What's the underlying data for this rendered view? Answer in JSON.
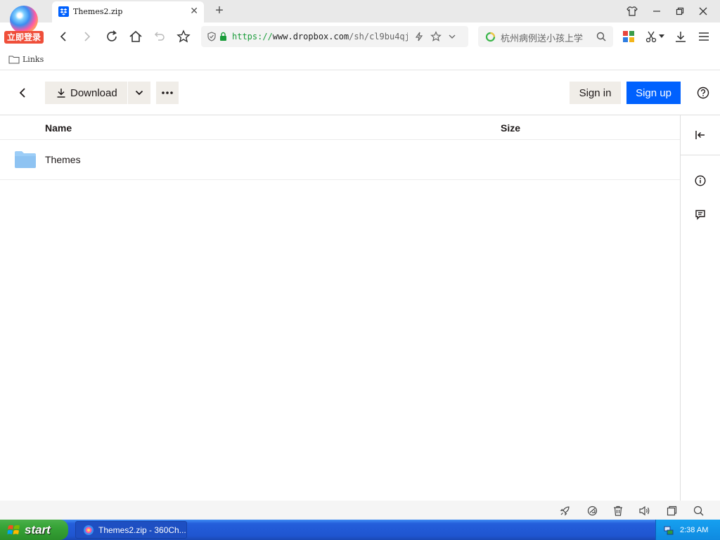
{
  "browser": {
    "logo_badge": "立即登录",
    "tab": {
      "title": "Themes2.zip"
    },
    "address": {
      "scheme": "https://",
      "host": "www.dropbox.com",
      "path": "/sh/cl9bu4qj"
    },
    "search": {
      "query": "杭州病例送小孩上学"
    },
    "bookmarks": [
      {
        "label": "Links"
      }
    ]
  },
  "page": {
    "toolbar": {
      "download_label": "Download",
      "signin_label": "Sign in",
      "signup_label": "Sign up"
    },
    "columns": {
      "name": "Name",
      "size": "Size"
    },
    "files": [
      {
        "name": "Themes",
        "size": ""
      }
    ]
  },
  "taskbar": {
    "start_label": "start",
    "task_label": "Themes2.zip - 360Ch...",
    "clock": "2:38 AM"
  },
  "colors": {
    "accent": "#0061fe",
    "button_bg": "#f0ede8",
    "folder": "#9ccdf7"
  }
}
